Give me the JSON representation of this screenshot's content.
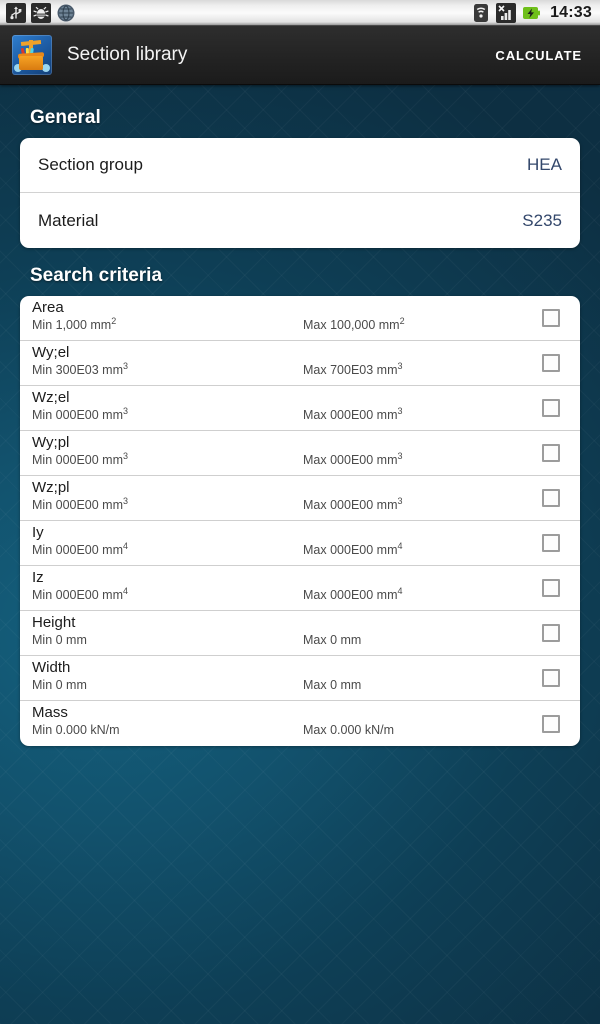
{
  "statusbar": {
    "time": "14:33",
    "left_icons": [
      "usb-icon",
      "android-debug-icon",
      "browser-globe-icon"
    ],
    "right_icons": [
      "wifi-icon",
      "signal-no-sim-icon",
      "battery-charging-icon"
    ]
  },
  "actionbar": {
    "app_icon": "section-library-app-icon",
    "title": "Section library",
    "action_label": "CALCULATE"
  },
  "general": {
    "heading": "General",
    "rows": [
      {
        "label": "Section group",
        "value": "HEA"
      },
      {
        "label": "Material",
        "value": "S235"
      }
    ]
  },
  "search_criteria": {
    "heading": "Search criteria",
    "rows": [
      {
        "name": "Area",
        "min": "Min 1,000 mm",
        "min_sup": "2",
        "max": "Max 100,000 mm",
        "max_sup": "2",
        "checked": false
      },
      {
        "name": "Wy;el",
        "min": "Min 300E03 mm",
        "min_sup": "3",
        "max": "Max 700E03 mm",
        "max_sup": "3",
        "checked": false
      },
      {
        "name": "Wz;el",
        "min": "Min 000E00 mm",
        "min_sup": "3",
        "max": "Max 000E00 mm",
        "max_sup": "3",
        "checked": false
      },
      {
        "name": "Wy;pl",
        "min": "Min 000E00 mm",
        "min_sup": "3",
        "max": "Max 000E00 mm",
        "max_sup": "3",
        "checked": false
      },
      {
        "name": "Wz;pl",
        "min": "Min 000E00 mm",
        "min_sup": "3",
        "max": "Max 000E00 mm",
        "max_sup": "3",
        "checked": false
      },
      {
        "name": "Iy",
        "min": "Min 000E00 mm",
        "min_sup": "4",
        "max": "Max 000E00 mm",
        "max_sup": "4",
        "checked": false
      },
      {
        "name": "Iz",
        "min": "Min 000E00 mm",
        "min_sup": "4",
        "max": "Max 000E00 mm",
        "max_sup": "4",
        "checked": false
      },
      {
        "name": "Height",
        "min": "Min 0 mm",
        "min_sup": "",
        "max": "Max 0 mm",
        "max_sup": "",
        "checked": false
      },
      {
        "name": "Width",
        "min": "Min 0 mm",
        "min_sup": "",
        "max": "Max 0 mm",
        "max_sup": "",
        "checked": false
      },
      {
        "name": "Mass",
        "min": "Min 0.000 kN/m",
        "min_sup": "",
        "max": "Max 0.000 kN/m",
        "max_sup": "",
        "checked": false
      }
    ]
  },
  "colors": {
    "accent_value": "#33476b",
    "card_bg": "#ffffff",
    "background_teal": "#12516c",
    "actionbar_bg": "#242424"
  }
}
